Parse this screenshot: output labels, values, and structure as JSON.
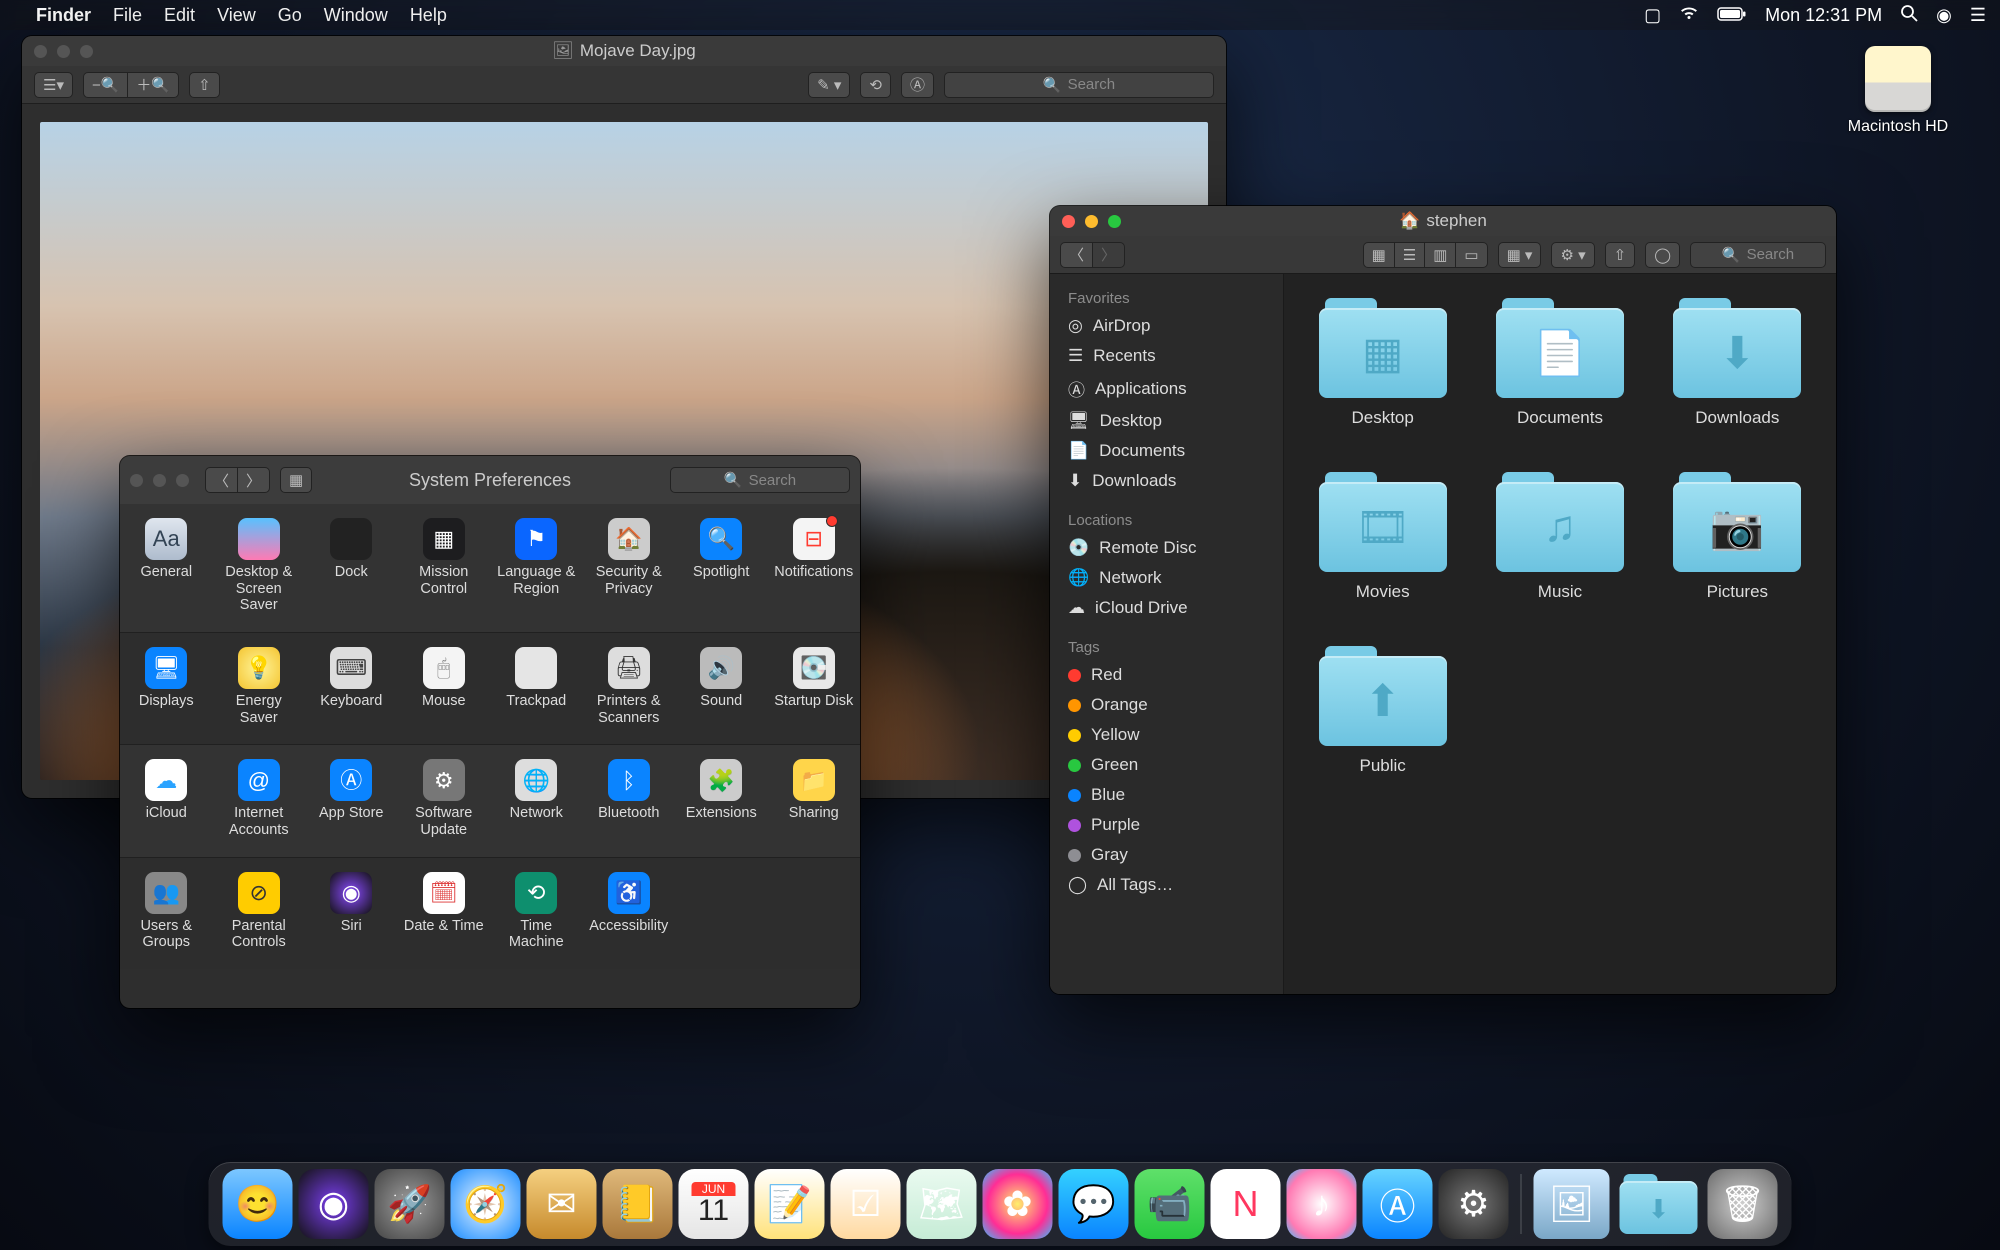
{
  "menubar": {
    "app": "Finder",
    "items": [
      "File",
      "Edit",
      "View",
      "Go",
      "Window",
      "Help"
    ],
    "clock": "Mon 12:31 PM"
  },
  "desktop": {
    "drive_label": "Macintosh HD"
  },
  "preview": {
    "title": "Mojave Day.jpg",
    "search_placeholder": "Search"
  },
  "sysprefs": {
    "title": "System Preferences",
    "search_placeholder": "Search",
    "rows": [
      [
        "General",
        "Desktop & Screen Saver",
        "Dock",
        "Mission Control",
        "Language & Region",
        "Security & Privacy",
        "Spotlight",
        "Notifications"
      ],
      [
        "Displays",
        "Energy Saver",
        "Keyboard",
        "Mouse",
        "Trackpad",
        "Printers & Scanners",
        "Sound",
        "Startup Disk"
      ],
      [
        "iCloud",
        "Internet Accounts",
        "App Store",
        "Software Update",
        "Network",
        "Bluetooth",
        "Extensions",
        "Sharing"
      ],
      [
        "Users & Groups",
        "Parental Controls",
        "Siri",
        "Date & Time",
        "Time Machine",
        "Accessibility"
      ]
    ]
  },
  "finder": {
    "title": "stephen",
    "search_placeholder": "Search",
    "sections": {
      "favorites_label": "Favorites",
      "favorites": [
        "AirDrop",
        "Recents",
        "Applications",
        "Desktop",
        "Documents",
        "Downloads"
      ],
      "locations_label": "Locations",
      "locations": [
        "Remote Disc",
        "Network",
        "iCloud Drive"
      ],
      "tags_label": "Tags",
      "tags": [
        {
          "label": "Red",
          "color": "#ff3b30"
        },
        {
          "label": "Orange",
          "color": "#ff9500"
        },
        {
          "label": "Yellow",
          "color": "#ffcc00"
        },
        {
          "label": "Green",
          "color": "#28c840"
        },
        {
          "label": "Blue",
          "color": "#0a84ff"
        },
        {
          "label": "Purple",
          "color": "#af52de"
        },
        {
          "label": "Gray",
          "color": "#8e8e93"
        }
      ],
      "all_tags": "All Tags…"
    },
    "folders": [
      "Desktop",
      "Documents",
      "Downloads",
      "Movies",
      "Music",
      "Pictures",
      "Public"
    ],
    "folder_symbols": [
      "▦",
      "📄",
      "⬇",
      "🎞",
      "♫",
      "📷",
      "⬆"
    ]
  },
  "dock": {
    "items": [
      "Finder",
      "Siri",
      "Launchpad",
      "Safari",
      "Mail",
      "Contacts",
      "Calendar",
      "Notes",
      "Reminders",
      "Maps",
      "Photos",
      "Messages",
      "FaceTime",
      "News",
      "iTunes",
      "App Store",
      "System Preferences"
    ],
    "calendar_day": "11",
    "calendar_month": "JUN",
    "right": [
      "Desktop picture",
      "Downloads",
      "Trash"
    ]
  }
}
